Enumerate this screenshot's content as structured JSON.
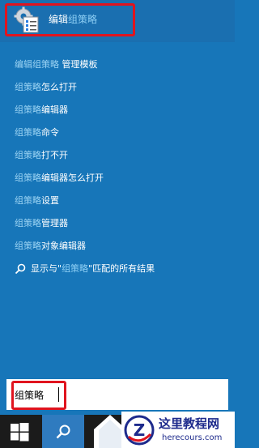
{
  "top_result": {
    "title_part1": "编辑",
    "title_part2": "组策略"
  },
  "suggestions": [
    {
      "hl": "编辑组策略",
      "rest": " 管理模板"
    },
    {
      "hl": "组策略",
      "rest": "怎么打开"
    },
    {
      "hl": "组策略",
      "rest": "编辑器"
    },
    {
      "hl": "组策略",
      "rest": "命令"
    },
    {
      "hl": "组策略",
      "rest": "打不开"
    },
    {
      "hl": "组策略",
      "rest": "编辑器怎么打开"
    },
    {
      "hl": "组策略",
      "rest": "设置"
    },
    {
      "hl": "组策略",
      "rest": "管理器"
    },
    {
      "hl": "组策略",
      "rest": "对象编辑器"
    }
  ],
  "web_search": {
    "prefix": "显示与\"",
    "hl": "组策略",
    "suffix": "\"匹配的所有结果"
  },
  "search": {
    "value": "组策略"
  },
  "watermark": {
    "title": "这里教程网",
    "url": "herecours.com"
  },
  "colors": {
    "background": "#1776b9",
    "highlight": "#9bd3f3",
    "red_box": "#e0141e",
    "taskbar": "#1b1b1b"
  }
}
